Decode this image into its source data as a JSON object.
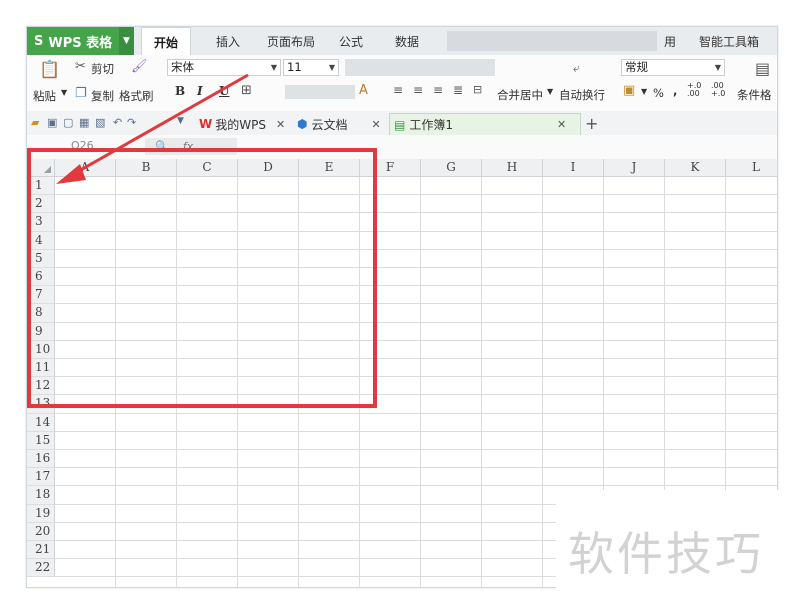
{
  "app": {
    "button_label": "WPS 表格",
    "logo_glyph": "S"
  },
  "menu": {
    "tabs": [
      "开始",
      "插入",
      "页面布局",
      "公式",
      "数据"
    ],
    "partial_tab_fragment": "用",
    "last_tab": "智能工具箱",
    "active": "开始"
  },
  "ribbon": {
    "paste": "粘贴",
    "cut": "剪切",
    "copy": "复制",
    "format_painter": "格式刷",
    "font_name": "宋体",
    "font_size": "11",
    "bold": "B",
    "italic": "I",
    "underline": "U",
    "merge_center": "合并居中",
    "wrap_text": "自动换行",
    "number_format": "常规",
    "percent": "%",
    "comma": ",",
    "inc_decimal": "+.0\n.00",
    "dec_decimal": ".00\n+.0",
    "conditional": "条件格"
  },
  "doc_tabs": [
    {
      "label": "我的WPS",
      "icon": "wps-logo-icon"
    },
    {
      "label": "云文档",
      "icon": "cloud-doc-icon"
    },
    {
      "label": "工作簿1",
      "icon": "workbook-icon",
      "active": true
    }
  ],
  "formula_bar": {
    "name_box": "O26",
    "fx": "fx"
  },
  "grid": {
    "columns": [
      "A",
      "B",
      "C",
      "D",
      "E",
      "F",
      "G",
      "H",
      "I",
      "J",
      "K",
      "L"
    ],
    "rows": [
      "1",
      "2",
      "3",
      "4",
      "5",
      "6",
      "7",
      "8",
      "9",
      "10",
      "11",
      "12",
      "13",
      "14",
      "15",
      "16",
      "17",
      "18",
      "19",
      "20",
      "21",
      "22"
    ]
  },
  "watermark": "软件技巧",
  "colors": {
    "brand_green": "#45a34a",
    "annotation_red": "#e03a3e"
  }
}
